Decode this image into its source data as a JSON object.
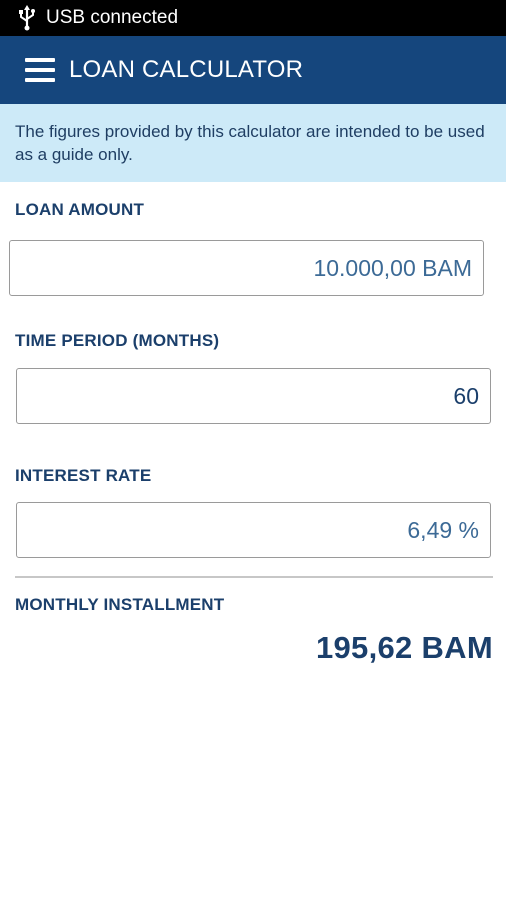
{
  "status_bar": {
    "icon": "usb-icon",
    "text": "USB connected"
  },
  "app_bar": {
    "menu_icon": "hamburger-menu-icon",
    "title": "LOAN CALCULATOR"
  },
  "notice": {
    "text": "The figures provided by this calculator are intended to be used as a guide only."
  },
  "form": {
    "loan_amount": {
      "label": "LOAN AMOUNT",
      "value": "10.000,00 BAM"
    },
    "time_period": {
      "label": "TIME PERIOD (MONTHS)",
      "value": "60"
    },
    "interest_rate": {
      "label": "INTEREST RATE",
      "value": "6,49 %"
    }
  },
  "result": {
    "label": "MONTHLY INSTALLMENT",
    "value": "195,62 BAM"
  },
  "colors": {
    "app_bar": "#15467d",
    "notice_bg": "#cdeaf8",
    "label_text": "#1b3f6b",
    "status_bar": "#000000"
  }
}
